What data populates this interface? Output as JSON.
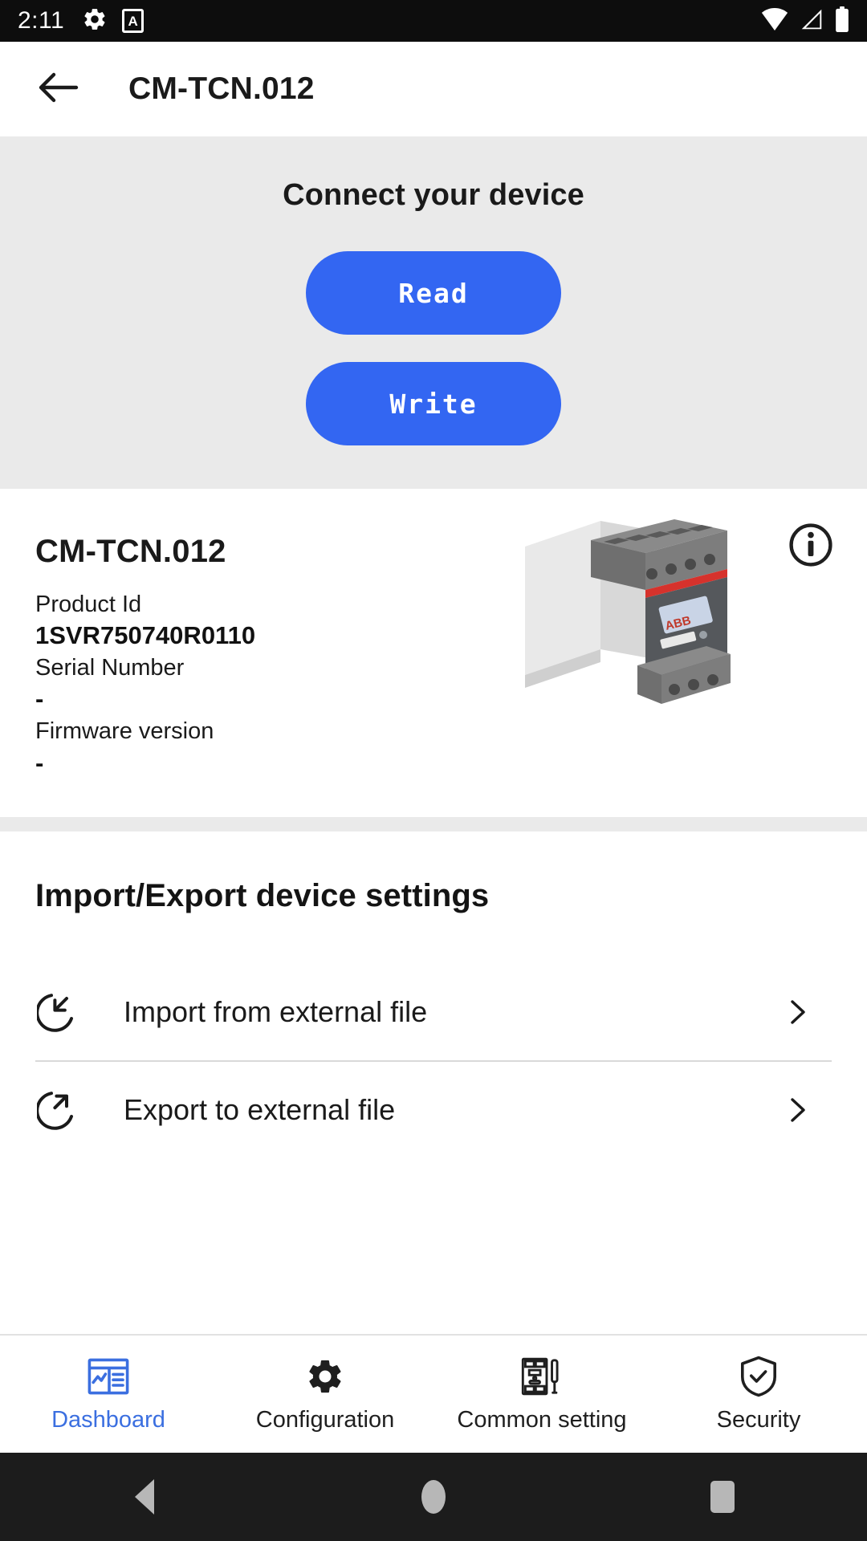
{
  "status_bar": {
    "time": "2:11",
    "left_icons": [
      "gear-icon",
      "a-notification-icon"
    ],
    "a_badge_letter": "A",
    "right_icons": [
      "wifi-icon",
      "cellular-signal-icon",
      "battery-icon"
    ]
  },
  "app_bar": {
    "back_icon": "back-arrow-icon",
    "title": "CM-TCN.012"
  },
  "connect_panel": {
    "title": "Connect your device",
    "read_label": "Read",
    "write_label": "Write",
    "button_color": "#3366f2",
    "background_color": "#eaeaea"
  },
  "device_card": {
    "name": "CM-TCN.012",
    "info_icon": "info-circle-icon",
    "product_image": "cm-tcn-relay-module-image",
    "specs": [
      {
        "label": "Product Id",
        "value": "1SVR750740R0110"
      },
      {
        "label": "Serial Number",
        "value": "-"
      },
      {
        "label": "Firmware version",
        "value": "-"
      }
    ]
  },
  "import_export": {
    "title": "Import/Export device settings",
    "rows": [
      {
        "icon": "import-arrow-icon",
        "label": "Import from external file",
        "chevron": "chevron-right-icon"
      },
      {
        "icon": "export-arrow-icon",
        "label": "Export to external file",
        "chevron": "chevron-right-icon"
      }
    ]
  },
  "bottom_nav": {
    "active_index": 0,
    "active_color": "#3b6fe0",
    "items": [
      {
        "icon": "dashboard-icon",
        "label": "Dashboard"
      },
      {
        "icon": "gear-icon",
        "label": "Configuration"
      },
      {
        "icon": "device-tool-icon",
        "label": "Common setting"
      },
      {
        "icon": "shield-check-icon",
        "label": "Security"
      }
    ]
  },
  "android_nav": {
    "back": "triangle-back-icon",
    "home": "circle-home-icon",
    "recents": "square-recents-icon"
  }
}
